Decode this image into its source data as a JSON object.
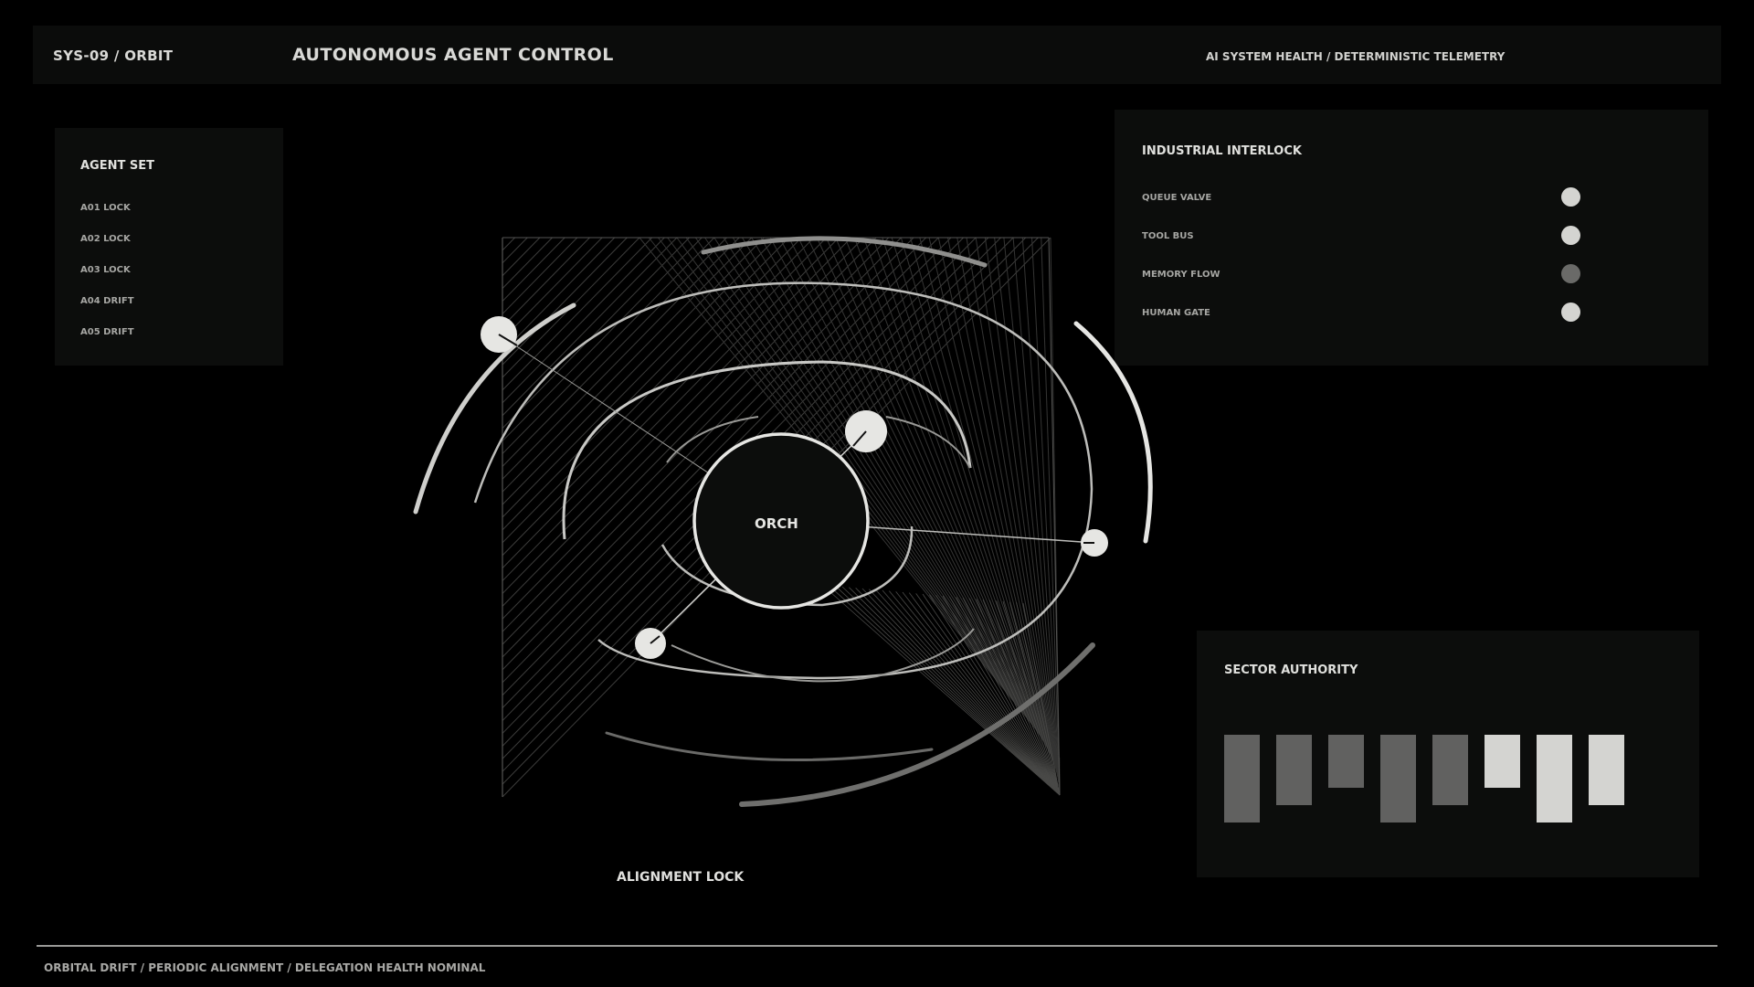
{
  "header": {
    "system_id": "SYS-09 / ORBIT",
    "title": "AUTONOMOUS AGENT CONTROL",
    "telemetry": "AI SYSTEM HEALTH / DETERMINISTIC TELEMETRY"
  },
  "agent_set": {
    "title": "AGENT SET",
    "items": [
      "A01 LOCK",
      "A02 LOCK",
      "A03 LOCK",
      "A04 DRIFT",
      "A05 DRIFT"
    ]
  },
  "interlock": {
    "title": "INDUSTRIAL INTERLOCK",
    "items": [
      {
        "label": "QUEUE VALVE",
        "color": "#d4d4d1"
      },
      {
        "label": "TOOL BUS",
        "color": "#d4d4d1"
      },
      {
        "label": "MEMORY FLOW",
        "color": "#6a6a68"
      },
      {
        "label": "HUMAN GATE",
        "color": "#d4d4d1"
      }
    ]
  },
  "sector": {
    "title": "SECTOR AUTHORITY",
    "bars": [
      {
        "value": 1.0,
        "offset": 0.0,
        "color": "#616160"
      },
      {
        "value": 0.8,
        "offset": 0.0,
        "color": "#616160"
      },
      {
        "value": 0.6,
        "offset": 0.0,
        "color": "#616160"
      },
      {
        "value": 1.0,
        "offset": 0.0,
        "color": "#616160"
      },
      {
        "value": 0.8,
        "offset": 0.0,
        "color": "#616160"
      },
      {
        "value": 0.6,
        "offset": 0.0,
        "color": "#d4d4d1"
      },
      {
        "value": 1.0,
        "offset": 0.0,
        "color": "#d4d4d1"
      },
      {
        "value": 0.8,
        "offset": 0.0,
        "color": "#d4d4d1"
      }
    ]
  },
  "orbit": {
    "center_label": "ORCH",
    "lock_label": "ALIGNMENT LOCK"
  },
  "footer": {
    "status": "ORBITAL DRIFT / PERIODIC ALIGNMENT / DELEGATION HEALTH NOMINAL"
  }
}
